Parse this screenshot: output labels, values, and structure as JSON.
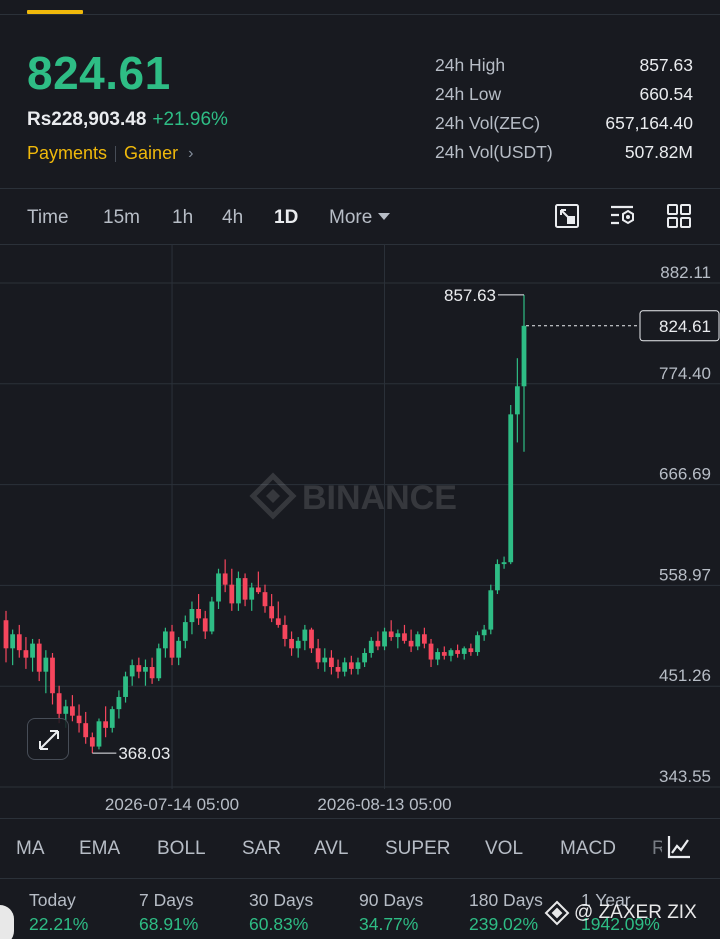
{
  "header": {
    "last_price": "824.61",
    "fiat_price": "Rs228,903.48",
    "change_pct": "+21.96%",
    "tags": [
      "Payments",
      "Gainer"
    ]
  },
  "stats": [
    {
      "label": "24h High",
      "value": "857.63"
    },
    {
      "label": "24h Low",
      "value": "660.54"
    },
    {
      "label": "24h Vol(ZEC)",
      "value": "657,164.40"
    },
    {
      "label": "24h Vol(USDT)",
      "value": "507.82M"
    }
  ],
  "intervals": [
    "Time",
    "15m",
    "1h",
    "4h",
    "1D",
    "More"
  ],
  "active_interval": "1D",
  "toolbar_icons": [
    "chart-settings-icon",
    "indicator-settings-icon",
    "grid-layout-icon"
  ],
  "chart_data": {
    "type": "candlestick",
    "watermark": "BINANCE",
    "y_axis_labels": [
      "882.11",
      "774.40",
      "666.69",
      "558.97",
      "451.26",
      "343.55"
    ],
    "y_axis_values": [
      882.11,
      774.4,
      666.69,
      558.97,
      451.26,
      343.55
    ],
    "ylim": [
      343.55,
      882.11
    ],
    "x_axis_labels": [
      "2026-07-14 05:00",
      "2026-08-13 05:00"
    ],
    "last_price_label": "824.61",
    "last_price": 824.61,
    "high_marker": {
      "label": "857.63",
      "value": 857.63
    },
    "low_marker": {
      "label": "368.03",
      "value": 368.03
    },
    "candles": [
      [
        510,
        520,
        465,
        480
      ],
      [
        480,
        500,
        462,
        495
      ],
      [
        495,
        505,
        470,
        478
      ],
      [
        478,
        492,
        458,
        470
      ],
      [
        470,
        490,
        455,
        485
      ],
      [
        485,
        490,
        445,
        455
      ],
      [
        455,
        478,
        432,
        470
      ],
      [
        470,
        475,
        420,
        432
      ],
      [
        432,
        440,
        400,
        410
      ],
      [
        410,
        425,
        395,
        418
      ],
      [
        418,
        430,
        402,
        408
      ],
      [
        408,
        420,
        390,
        400
      ],
      [
        400,
        412,
        378,
        385
      ],
      [
        385,
        390,
        368,
        375
      ],
      [
        375,
        405,
        372,
        402
      ],
      [
        402,
        418,
        385,
        395
      ],
      [
        395,
        418,
        390,
        415
      ],
      [
        415,
        435,
        405,
        428
      ],
      [
        428,
        455,
        422,
        450
      ],
      [
        450,
        468,
        440,
        462
      ],
      [
        462,
        470,
        448,
        455
      ],
      [
        455,
        468,
        440,
        460
      ],
      [
        460,
        470,
        442,
        448
      ],
      [
        448,
        485,
        445,
        480
      ],
      [
        480,
        502,
        470,
        498
      ],
      [
        498,
        505,
        462,
        470
      ],
      [
        470,
        492,
        462,
        488
      ],
      [
        488,
        515,
        480,
        508
      ],
      [
        508,
        530,
        495,
        522
      ],
      [
        522,
        538,
        505,
        512
      ],
      [
        512,
        520,
        490,
        498
      ],
      [
        498,
        535,
        495,
        530
      ],
      [
        530,
        565,
        522,
        560
      ],
      [
        560,
        575,
        540,
        548
      ],
      [
        548,
        565,
        520,
        528
      ],
      [
        528,
        562,
        520,
        555
      ],
      [
        555,
        560,
        525,
        532
      ],
      [
        532,
        550,
        520,
        545
      ],
      [
        545,
        562,
        538,
        540
      ],
      [
        540,
        548,
        518,
        525
      ],
      [
        525,
        538,
        508,
        512
      ],
      [
        512,
        530,
        502,
        505
      ],
      [
        505,
        515,
        482,
        490
      ],
      [
        490,
        498,
        472,
        480
      ],
      [
        480,
        492,
        470,
        488
      ],
      [
        488,
        505,
        478,
        500
      ],
      [
        500,
        502,
        475,
        480
      ],
      [
        480,
        490,
        458,
        465
      ],
      [
        465,
        480,
        455,
        470
      ],
      [
        470,
        478,
        452,
        460
      ],
      [
        460,
        468,
        448,
        455
      ],
      [
        455,
        470,
        450,
        465
      ],
      [
        465,
        472,
        452,
        458
      ],
      [
        458,
        470,
        452,
        465
      ],
      [
        465,
        480,
        460,
        475
      ],
      [
        475,
        492,
        470,
        488
      ],
      [
        488,
        498,
        478,
        482
      ],
      [
        482,
        502,
        478,
        498
      ],
      [
        498,
        510,
        488,
        492
      ],
      [
        492,
        500,
        480,
        496
      ],
      [
        496,
        505,
        485,
        488
      ],
      [
        488,
        500,
        476,
        482
      ],
      [
        482,
        498,
        478,
        495
      ],
      [
        495,
        502,
        480,
        485
      ],
      [
        485,
        490,
        460,
        468
      ],
      [
        468,
        480,
        462,
        476
      ],
      [
        476,
        482,
        468,
        472
      ],
      [
        472,
        480,
        466,
        478
      ],
      [
        478,
        484,
        470,
        474
      ],
      [
        474,
        482,
        468,
        480
      ],
      [
        480,
        485,
        472,
        476
      ],
      [
        476,
        498,
        472,
        494
      ],
      [
        494,
        505,
        488,
        500
      ],
      [
        500,
        548,
        495,
        542
      ],
      [
        542,
        575,
        538,
        570
      ],
      [
        570,
        578,
        565,
        572
      ],
      [
        572,
        740,
        570,
        730
      ],
      [
        730,
        790,
        700,
        760
      ],
      [
        760,
        857.63,
        690,
        824.61
      ]
    ]
  },
  "indicators": [
    "MA",
    "EMA",
    "BOLL",
    "SAR",
    "AVL",
    "SUPER",
    "VOL",
    "MACD",
    "R"
  ],
  "performance": [
    {
      "label": "Today",
      "value": "22.21%"
    },
    {
      "label": "7 Days",
      "value": "68.91%"
    },
    {
      "label": "30 Days",
      "value": "60.83%"
    },
    {
      "label": "90 Days",
      "value": "34.77%"
    },
    {
      "label": "180 Days",
      "value": "239.02%"
    },
    {
      "label": "1 Year",
      "value": "1942.09%"
    }
  ],
  "watermark_user": "@ ZAXER ZIX"
}
